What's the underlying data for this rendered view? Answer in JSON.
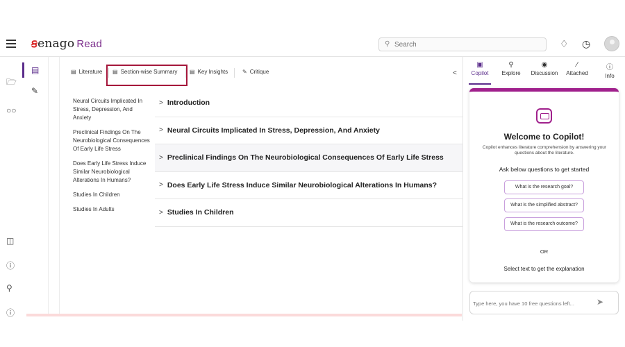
{
  "header": {
    "logo_mark": "ꞩ",
    "logo_text": "enago",
    "logo_product": "Read",
    "search_placeholder": "Search",
    "icons": [
      "menu-icon",
      "bell-icon",
      "alarm-clock-icon",
      "avatar"
    ]
  },
  "left_rail": {
    "icons": [
      "folder-icon",
      "glasses-icon",
      "gift-icon",
      "help-icon",
      "lightbulb-icon",
      "info-icon"
    ]
  },
  "secondary_rail": {
    "icons": [
      "document-icon",
      "edit-document-icon"
    ]
  },
  "tabs": [
    {
      "label": "Literature",
      "icon": "document-icon"
    },
    {
      "label": "Section-wise Summary",
      "icon": "clipboard-icon",
      "active": true
    },
    {
      "label": "Key Insights",
      "icon": "document-list-icon"
    },
    {
      "label": "Critique",
      "icon": "edit-icon"
    }
  ],
  "toc": [
    "Neural Circuits Implicated In Stress, Depression, And Anxiety",
    "Preclinical Findings On The Neurobiological Consequences Of Early Life Stress",
    "Does Early Life Stress Induce Similar Neurobiological Alterations In Humans?",
    "Studies In Children",
    "Studies In Adults"
  ],
  "sections": [
    "Introduction",
    "Neural Circuits Implicated In Stress, Depression, And Anxiety",
    "Preclinical Findings On The Neurobiological Consequences Of Early Life Stress",
    "Does Early Life Stress Induce Similar Neurobiological Alterations In Humans?",
    "Studies In Children"
  ],
  "right_tabs": [
    {
      "label": "Copilot",
      "icon": "copilot-icon",
      "active": true
    },
    {
      "label": "Explore",
      "icon": "explore-icon"
    },
    {
      "label": "Discussion",
      "icon": "discussion-icon"
    },
    {
      "label": "Attached",
      "icon": "paperclip-icon"
    },
    {
      "label": "Info",
      "icon": "info-icon"
    }
  ],
  "copilot": {
    "title": "Welcome to Copilot!",
    "description": "Copilot enhances literature comprehension by answering your questions about the literature.",
    "ask_label": "Ask below questions to get started",
    "questions": [
      "What is the research goal?",
      "What is the simplified abstract?",
      "What is the research outcome?"
    ],
    "or_label": "OR",
    "select_label": "Select text to get the explanation",
    "chat_placeholder": "Type here, you have 10 free questions left...",
    "accent_color": "#a0208c"
  }
}
